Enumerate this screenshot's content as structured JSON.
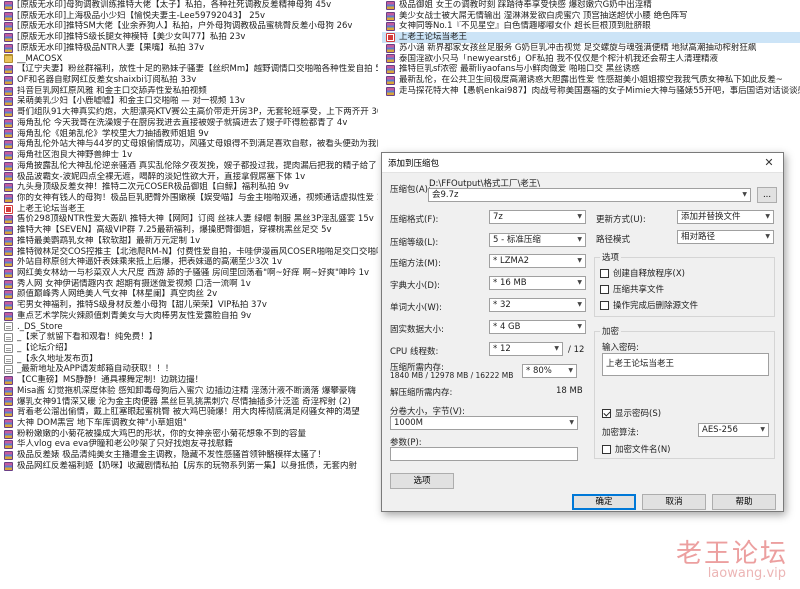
{
  "left_files": [
    {
      "icon": "rar",
      "text": "[原版无水印]母狗调教训练推特大佬【太子】私拍，各种社死调教反差精神母狗 45v"
    },
    {
      "icon": "rar",
      "text": "[原版无水印]上海极品小少妇【愉悦夫妻主-Lee59792043】 25v"
    },
    {
      "icon": "rar",
      "text": "[原版无水印]推特SM大佬【业余养狗人】私拍，户外母狗调教极品蜜桃臀反差小母狗 26v"
    },
    {
      "icon": "rar",
      "text": "[原版无水印]推特S级长腿女神模特【美少女叫77】私拍 23v"
    },
    {
      "icon": "rar",
      "text": "[原版无水印]推特极品NTR人妻【果嘴】私拍 37v"
    },
    {
      "icon": "folder",
      "text": "__MACOSX"
    },
    {
      "icon": "rar",
      "text": "【辽宁夫妻】粉丝群福利，放性十足的熟妹子骚妻【丝织Mm】越野调情口交啪啪各种性爱自拍 51v"
    },
    {
      "icon": "rar",
      "text": "OF和名器自慰网红反差女shaixbi订阅私拍 33v"
    },
    {
      "icon": "rar",
      "text": "抖音巨乳网红原风雅 和金主口交舔弄性爱私拍视频"
    },
    {
      "icon": "rar",
      "text": "呆萌美乳少妇【小鹿嘘嘘】和金主口交啪啪 — 对一视频 13v"
    },
    {
      "icon": "rar",
      "text": "哥们组队91大神真实约炮，大胆漂亮KTV赛公主高价带走开房3P，无套轮班享受，上下两齐开 30v"
    },
    {
      "icon": "rar",
      "text": "海角乱伦 今天我哥在洗澡嫂子在厨房我进去直接被嫂子就搞进去了嫂子吓得脸都青了 4v"
    },
    {
      "icon": "rar",
      "text": "海角乱伦《姐弟乱伦》学校里大力抽插教师姐姐 9v"
    },
    {
      "icon": "rar",
      "text": "海角乱伦外站大神与44岁的丈母娘偷情成功，风骚丈母娘得不到满足喜欢自慰，被看头便劲为我口交 4v"
    },
    {
      "icon": "rar",
      "text": "海角社区泡良大神野兽绅士 1v"
    },
    {
      "icon": "rar",
      "text": "海角披露乱伦大神乱伦逆亲骚酒 真实乱伦除夕夜发挽，嫂子都投过我，提肉漏后把我的精子给了 1v"
    },
    {
      "icon": "rar",
      "text": "极品波霸女-波妮四点全裸无遮，喝醉的淡妃性欲大开，直接拿假屌塞下体 1v"
    },
    {
      "icon": "rar",
      "text": "九头身顶级反差女神！推特二次元COSER极品御姐【白鲸】福利私拍 9v"
    },
    {
      "icon": "rar",
      "text": "你的女神有钱人的母狗！极品巨乳肥臀外围嫩模【娱受喵】与金主啪啪双通，视频通话虚拟性爱 14v"
    },
    {
      "icon": "red",
      "text": "上老王论坛当老王"
    },
    {
      "icon": "rar",
      "text": "售价298顶级NTR性爱大轰趴 推特大神【网阿】订阅 丝袜人妻 绿帽 制服 黑丝3P淫乱盛宴 15v"
    },
    {
      "icon": "rar",
      "text": "推特大神【SEVEN】高级VIP群 7.25最新福利，爆操肥臀御姐，穿裸桃黑丝足交 5v"
    },
    {
      "icon": "rar",
      "text": "推特最美鹦鹉乳女神【软软甜】最新万元定制 1v"
    },
    {
      "icon": "rar",
      "text": "推特微林足交COS控推主【北池爬RM-N】付费性爱自拍，卡哇伊漫画风COSER啪啪足交口交啪啪 14v"
    },
    {
      "icon": "rar",
      "text": "外站自称原创大神逼奸表妹乘来抵上后爆，把表妹逼的高潮至少3次 1v"
    },
    {
      "icon": "rar",
      "text": "网红美女林幼一与杉菜双人大尺度 西游 舔的子骚骚 房间里回荡着\"啊~好痒 啊~好爽\"呻吟 1v"
    },
    {
      "icon": "rar",
      "text": "秀人网 女神伊诺情趣内衣 超期有摄迷做爱视频 口活一流啊 1v"
    },
    {
      "icon": "rar",
      "text": "颜值巅峰秀人网绝美人气女神【林星阑】真空肉丝 2v"
    },
    {
      "icon": "rar",
      "text": "宅男女神福利，推特S级身材反差小母狗【甜儿荣荣】VIP私拍 37v"
    },
    {
      "icon": "rar",
      "text": "重点艺术学院火辣颜值刺青美女与大肉棒男友性爱露脸自拍 9v"
    },
    {
      "icon": "doc",
      "text": "._DS_Store"
    },
    {
      "icon": "doc",
      "text": "_【来了就留下看和观看！纯免费！】"
    },
    {
      "icon": "doc",
      "text": "_【论坛介绍】"
    },
    {
      "icon": "doc",
      "text": "_【永久地址发布页】"
    },
    {
      "icon": "doc",
      "text": "_最新地址及APP请发邮箱自动获取！！！"
    },
    {
      "icon": "rar",
      "text": "【CC重磅】MS静静！通具裸舞定制！边跳边撮！"
    },
    {
      "icon": "rar",
      "text": "Misa酱 幻觉拖机深度体验 感知卸毒母狗后入蜜穴 边插边注精 淫荡汁液不断滴落 爆攀豪嗨"
    },
    {
      "icon": "rar",
      "text": "爆乳女神91情深又暖 沦为金主肉便器 黑丝巨乳挑黑刺穴 尽情抽插多汁泛滥 奇淫榨射 (2)"
    },
    {
      "icon": "rar",
      "text": "背着老公溜出偷情，戴上肛塞眼起蜜桃臀 被大鸡巴骑爆！用大肉棒彻底满足闷骚女神的渴望"
    },
    {
      "icon": "rar",
      "text": "大神 DOM黑宫 地下车库调教女神\"小草姐姐\""
    },
    {
      "icon": "rar",
      "text": "粉粉嫩嫩的小菊花被操成大鸡巴的形状，你的女神亲密小菊花想象不到的容量"
    },
    {
      "icon": "rar",
      "text": "华人vlog eva eva伊瞳和老公吵架了只好找炮友寻找慰籍"
    },
    {
      "icon": "rar",
      "text": "极品反差婊 极品清纯美女主播遭金主调教，隐藏不发性感骚首领钟骼模样太骚了！"
    },
    {
      "icon": "rar",
      "text": "极品网红反差福利姬【奶咪】收藏剧情私拍【房东的玩物系列第一集】以身抵债，无套内射"
    }
  ],
  "right_files": [
    {
      "icon": "rar",
      "text": "极品御姐 女王の调教时刻 踩踏待奉享受快感 爆怼嫩穴G奶中出淫精"
    },
    {
      "icon": "rar",
      "text": "美少女战士被大屌无情输出 湿淋淋爱欲白虎蜜穴 顶宫抽送超伏小腰 绝色阵写"
    },
    {
      "icon": "rar",
      "text": "女神同等No.1『不见星空』白色情趣嘟嘟女仆 超长巨根顶到肚脐眼"
    },
    {
      "icon": "red",
      "text": "上老王论坛当老王",
      "selected": true
    },
    {
      "icon": "rar",
      "text": "苏小涵 新界都家女孩丝足服务 G奶巨乳冲击视觉 足交螺旋与魂强满便精 地狱高潮抽动榨射狂飙"
    },
    {
      "icon": "rar",
      "text": "泰国淫欲小只马「newyearst6」OF私拍 我不仅仅是个榨汁机我还会帮主人清理精液"
    },
    {
      "icon": "rar",
      "text": "推特巨乳sf浓密 最新liyaofans与小鲜肉做爱 啪啪口交 黑丝诱惑"
    },
    {
      "icon": "rar",
      "text": "最新乱伦，在公共卫生间极度高潮诱惑大胆露出性爱 性感甜美小姐姐擦空我我气质女神私下如此反差~"
    },
    {
      "icon": "rar",
      "text": "走马探花特大神【愚帆enkai987】肉战号称美国嘉福的女子Mimie大神与骚婊55开吧，事后国语对话谈谈感受"
    }
  ],
  "dialog": {
    "title": "添加到压缩包",
    "close_glyph": "✕",
    "archive_label": "压缩包(A):",
    "archive_path": "D:\\FFOutput\\格式工厂\\老王\\",
    "archive_name": "会9.7z",
    "browse_label": "...",
    "format_label": "压缩格式(F):",
    "format_value": "7z",
    "level_label": "压缩等级(L):",
    "level_value": "5 - 标准压缩",
    "method_label": "压缩方法(M):",
    "method_value": "* LZMA2",
    "dict_label": "字典大小(D):",
    "dict_value": "* 16 MB",
    "word_label": "单词大小(W):",
    "word_value": "* 32",
    "solid_label": "固实数据大小:",
    "solid_value": "* 4 GB",
    "threads_label": "CPU 线程数:",
    "threads_value": "* 12",
    "threads_max": "/ 12",
    "mem_comp_label": "压缩所需内存:",
    "mem_comp_value": "1840 MB / 12978 MB / 16222 MB",
    "mem_percent": "* 80%",
    "mem_decomp_label": "解压缩所需内存:",
    "mem_decomp_value": "18 MB",
    "split_label": "分卷大小，字节(V):",
    "split_value": "1000M",
    "params_label": "参数(P):",
    "params_value": "",
    "options_button": "选项",
    "update_label": "更新方式(U):",
    "update_value": "添加并替换文件",
    "path_label": "路径模式",
    "path_value": "相对路径",
    "opts_group": "选项",
    "opt_sfx": "创建自释放程序(X)",
    "opt_shared": "压缩共享文件",
    "opt_delete": "操作完成后删除源文件",
    "enc_group": "加密",
    "pwd_label": "输入密码:",
    "pwd_value": "上老王论坛当老王",
    "show_pwd": "显示密码(S)",
    "enc_method_label": "加密算法:",
    "enc_method_value": "AES-256",
    "enc_names": "加密文件名(N)",
    "ok_button": "确定",
    "cancel_button": "取消",
    "help_button": "帮助"
  },
  "watermark": {
    "cn": "老王论坛",
    "url": "laowang.vip"
  }
}
